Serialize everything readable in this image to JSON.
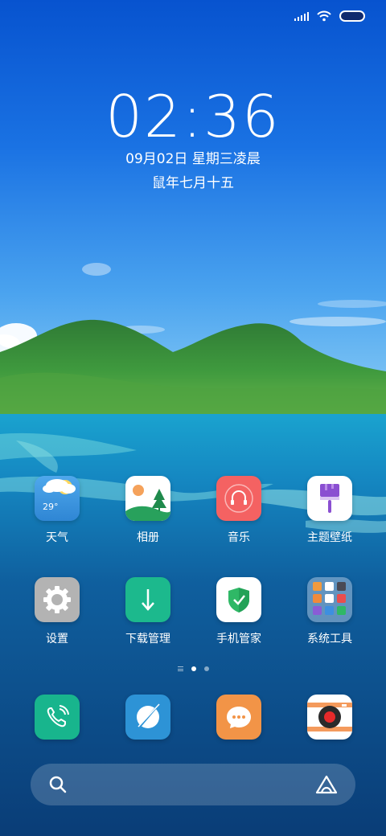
{
  "status_bar": {
    "icons": [
      "signal-icon",
      "wifi-icon",
      "battery-icon"
    ]
  },
  "clock": {
    "time": "02:36",
    "date_line": "09月02日 星期三凌晨",
    "lunar_line": "鼠年七月十五"
  },
  "apps": [
    {
      "label": "天气",
      "icon": "weather-icon",
      "temp": "29°"
    },
    {
      "label": "相册",
      "icon": "gallery-icon"
    },
    {
      "label": "音乐",
      "icon": "music-icon"
    },
    {
      "label": "主题壁纸",
      "icon": "themes-icon"
    },
    {
      "label": "设置",
      "icon": "settings-icon"
    },
    {
      "label": "下载管理",
      "icon": "downloads-icon"
    },
    {
      "label": "手机管家",
      "icon": "security-icon"
    },
    {
      "label": "系统工具",
      "icon": "tools-folder-icon"
    }
  ],
  "dock": [
    {
      "icon": "phone-icon"
    },
    {
      "icon": "browser-icon"
    },
    {
      "icon": "messages-icon"
    },
    {
      "icon": "camera-icon"
    }
  ],
  "page_indicator": {
    "pages": 2,
    "active": 1
  },
  "search": {
    "icons": [
      "search-icon",
      "assistant-icon"
    ]
  },
  "colors": {
    "weather": "#3f9be0",
    "gallery": "#ffffff",
    "music": "#f25b5b",
    "themes": "#ffffff",
    "settings": "#b5b5b5",
    "downloads": "#1cb98d",
    "security": "#ffffff",
    "folder": "rgba(255,255,255,0.35)",
    "phone": "#18b58d",
    "browser": "#2d93d6",
    "messages": "#f29447",
    "camera": "#ffffff"
  }
}
